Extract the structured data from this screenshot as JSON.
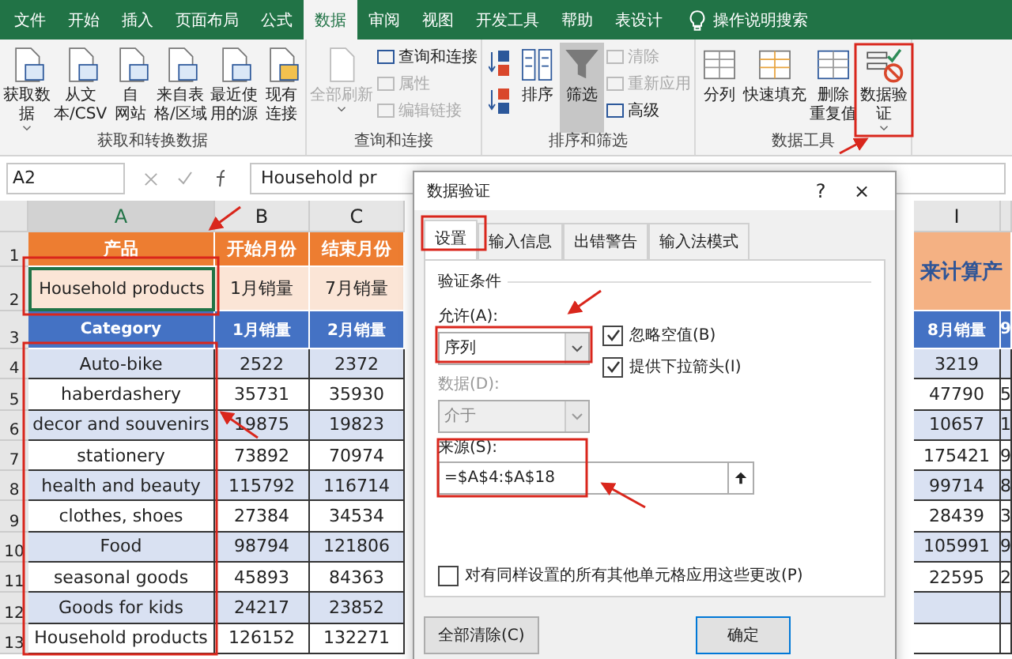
{
  "menu_tabs": [
    {
      "label": "文件",
      "selected": false
    },
    {
      "label": "开始",
      "selected": false
    },
    {
      "label": "插入",
      "selected": false
    },
    {
      "label": "页面布局",
      "selected": false
    },
    {
      "label": "公式",
      "selected": false
    },
    {
      "label": "数据",
      "selected": true
    },
    {
      "label": "审阅",
      "selected": false
    },
    {
      "label": "视图",
      "selected": false
    },
    {
      "label": "开发工具",
      "selected": false
    },
    {
      "label": "帮助",
      "selected": false
    },
    {
      "label": "表设计",
      "selected": false
    }
  ],
  "search": {
    "placeholder": "操作说明搜索"
  },
  "ribbon": {
    "groups": [
      {
        "label": "获取和转换数据",
        "items": [
          {
            "kind": "large",
            "lines": [
              "获取数",
              "据"
            ],
            "dropdown": true,
            "disabled": false
          },
          {
            "kind": "large",
            "lines": [
              "从文",
              "本/CSV"
            ],
            "dropdown": false,
            "disabled": false
          },
          {
            "kind": "large",
            "lines": [
              "自",
              "网站"
            ],
            "dropdown": false,
            "disabled": false
          },
          {
            "kind": "large",
            "lines": [
              "来自表",
              "格/区域"
            ],
            "dropdown": false,
            "disabled": false
          },
          {
            "kind": "large",
            "lines": [
              "最近使",
              "用的源"
            ],
            "dropdown": false,
            "disabled": false
          },
          {
            "kind": "large",
            "lines": [
              "现有",
              "连接"
            ],
            "dropdown": false,
            "disabled": false
          }
        ]
      },
      {
        "label": "查询和连接",
        "items": [
          {
            "kind": "large",
            "lines": [
              "全部刷新"
            ],
            "dropdown": true,
            "disabled": true
          },
          {
            "kind": "stack",
            "items": [
              {
                "label": "查询和连接",
                "disabled": false
              },
              {
                "label": "属性",
                "disabled": true
              },
              {
                "label": "编辑链接",
                "disabled": true
              }
            ]
          }
        ]
      },
      {
        "label": "排序和筛选",
        "items": [
          {
            "kind": "sort"
          },
          {
            "kind": "large",
            "lines": [
              "排序"
            ],
            "dropdown": false,
            "disabled": false
          },
          {
            "kind": "large",
            "lines": [
              "筛选"
            ],
            "dropdown": false,
            "disabled": false,
            "selected": true
          },
          {
            "kind": "stack",
            "items": [
              {
                "label": "清除",
                "disabled": true
              },
              {
                "label": "重新应用",
                "disabled": true
              },
              {
                "label": "高级",
                "disabled": false
              }
            ]
          }
        ]
      },
      {
        "label": "数据工具",
        "items": [
          {
            "kind": "large",
            "lines": [
              "分列"
            ],
            "dropdown": false,
            "disabled": false
          },
          {
            "kind": "large",
            "lines": [
              "快速填充"
            ],
            "dropdown": false,
            "disabled": false
          },
          {
            "kind": "large",
            "lines": [
              "删除",
              "重复值"
            ],
            "dropdown": false,
            "disabled": false
          },
          {
            "kind": "large",
            "lines": [
              "数据验",
              "证"
            ],
            "dropdown": true,
            "disabled": false
          }
        ]
      }
    ]
  },
  "formula_bar": {
    "name_box": "A2",
    "formula": "Household pr"
  },
  "sheet": {
    "columns": [
      {
        "label": "A",
        "selected": true
      },
      {
        "label": "B",
        "selected": false
      },
      {
        "label": "C",
        "selected": false
      },
      {
        "label": "I",
        "selected": false
      }
    ],
    "rows": [
      {
        "number": "1",
        "kind": "title",
        "a": "产品",
        "b": "开始月份",
        "c": "结束月份",
        "i": "来计算产"
      },
      {
        "number": "2",
        "kind": "input",
        "a": "Household products",
        "b": "1月销量",
        "c": "7月销量"
      },
      {
        "number": "3",
        "kind": "header",
        "a": "Category",
        "b": "1月销量",
        "c": "2月销量",
        "i": "8月销量",
        "j": "9"
      },
      {
        "number": "4",
        "kind": "band",
        "a": "Auto-bike",
        "b": "2522",
        "c": "2372",
        "i": "3219"
      },
      {
        "number": "5",
        "kind": "plain",
        "a": "haberdashery",
        "b": "35731",
        "c": "35930",
        "i": "47790",
        "j": "5"
      },
      {
        "number": "6",
        "kind": "band",
        "a": "decor and souvenirs",
        "b": "19875",
        "c": "19823",
        "i": "10657",
        "j": "1"
      },
      {
        "number": "7",
        "kind": "plain",
        "a": "stationery",
        "b": "73892",
        "c": "70974",
        "i": "175421",
        "j": "9"
      },
      {
        "number": "8",
        "kind": "band",
        "a": "health and beauty",
        "b": "115792",
        "c": "116714",
        "i": "99714",
        "j": "8"
      },
      {
        "number": "9",
        "kind": "plain",
        "a": "clothes, shoes",
        "b": "27384",
        "c": "34534",
        "i": "28439",
        "j": "3"
      },
      {
        "number": "10",
        "kind": "band",
        "a": "Food",
        "b": "98794",
        "c": "121806",
        "i": "105991",
        "j": "9"
      },
      {
        "number": "11",
        "kind": "plain",
        "a": "seasonal goods",
        "b": "45893",
        "c": "84363",
        "i": "22595",
        "j": "2"
      },
      {
        "number": "12",
        "kind": "band",
        "a": "Goods for kids",
        "b": "24217",
        "c": "23852"
      },
      {
        "number": "13",
        "kind": "plain",
        "a": "Household products",
        "b": "126152",
        "c": "132271"
      }
    ]
  },
  "dialog": {
    "title": "数据验证",
    "help": "?",
    "close": "×",
    "tabs": [
      {
        "label": "设置",
        "selected": true
      },
      {
        "label": "输入信息",
        "selected": false
      },
      {
        "label": "出错警告",
        "selected": false
      },
      {
        "label": "输入法模式",
        "selected": false
      }
    ],
    "section": "验证条件",
    "allow": {
      "label": "允许(A):",
      "value": "序列"
    },
    "checks": [
      {
        "label": "忽略空值(B)",
        "checked": true
      },
      {
        "label": "提供下拉箭头(I)",
        "checked": true
      }
    ],
    "data": {
      "label": "数据(D):",
      "value": "介于",
      "disabled": true
    },
    "source": {
      "label": "来源(S):",
      "value": "=$A$4:$A$18"
    },
    "apply_all": {
      "label": "对有同样设置的所有其他单元格应用这些更改(P)",
      "checked": false
    },
    "buttons": [
      "全部清除(C)",
      "确定"
    ]
  }
}
